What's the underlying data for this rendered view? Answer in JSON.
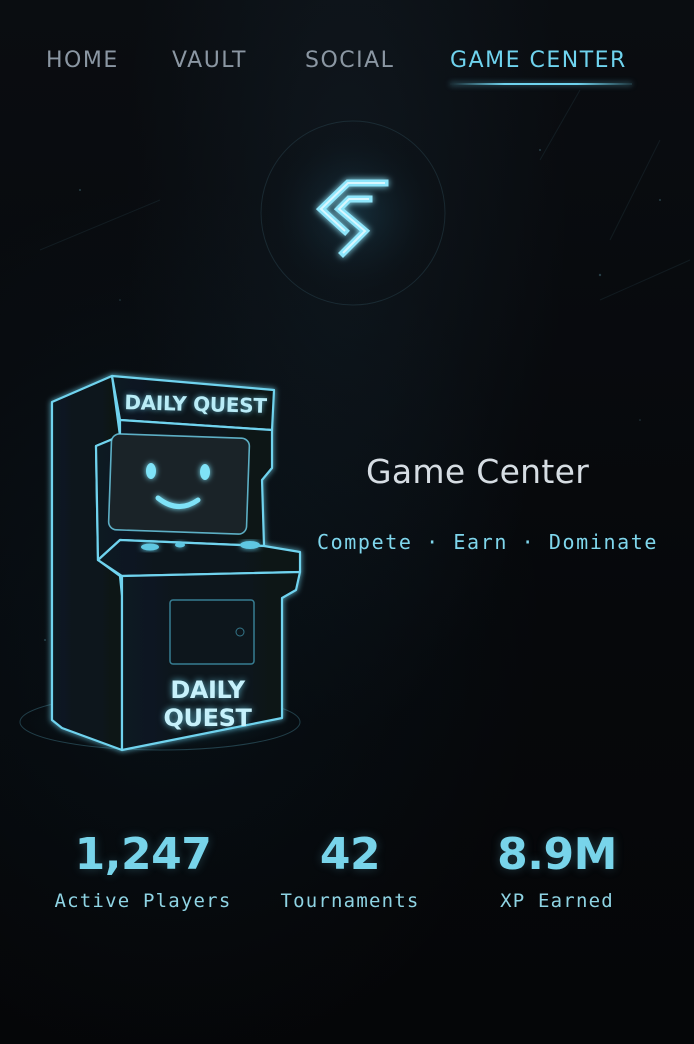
{
  "nav": {
    "items": [
      {
        "label": "HOME"
      },
      {
        "label": "VAULT"
      },
      {
        "label": "SOCIAL"
      },
      {
        "label": "GAME CENTER"
      }
    ],
    "active": "GAME CENTER"
  },
  "logo": {
    "icon": "gc-logo-icon"
  },
  "arcade": {
    "marquee": "DAILY QUEST",
    "door_line1": "DAILY",
    "door_line2": "QUEST",
    "screen_face": "smiley-face-icon"
  },
  "hero": {
    "title": "Game Center",
    "tagline": "Compete · Earn · Dominate"
  },
  "stats": [
    {
      "value": "1,247",
      "label": "Active Players"
    },
    {
      "value": "42",
      "label": "Tournaments"
    },
    {
      "value": "8.9M",
      "label": "XP Earned"
    }
  ],
  "colors": {
    "accent": "#6fd3ee",
    "background": "#07090c",
    "nav_inactive": "#8b97a3",
    "title": "#d6dde3"
  }
}
